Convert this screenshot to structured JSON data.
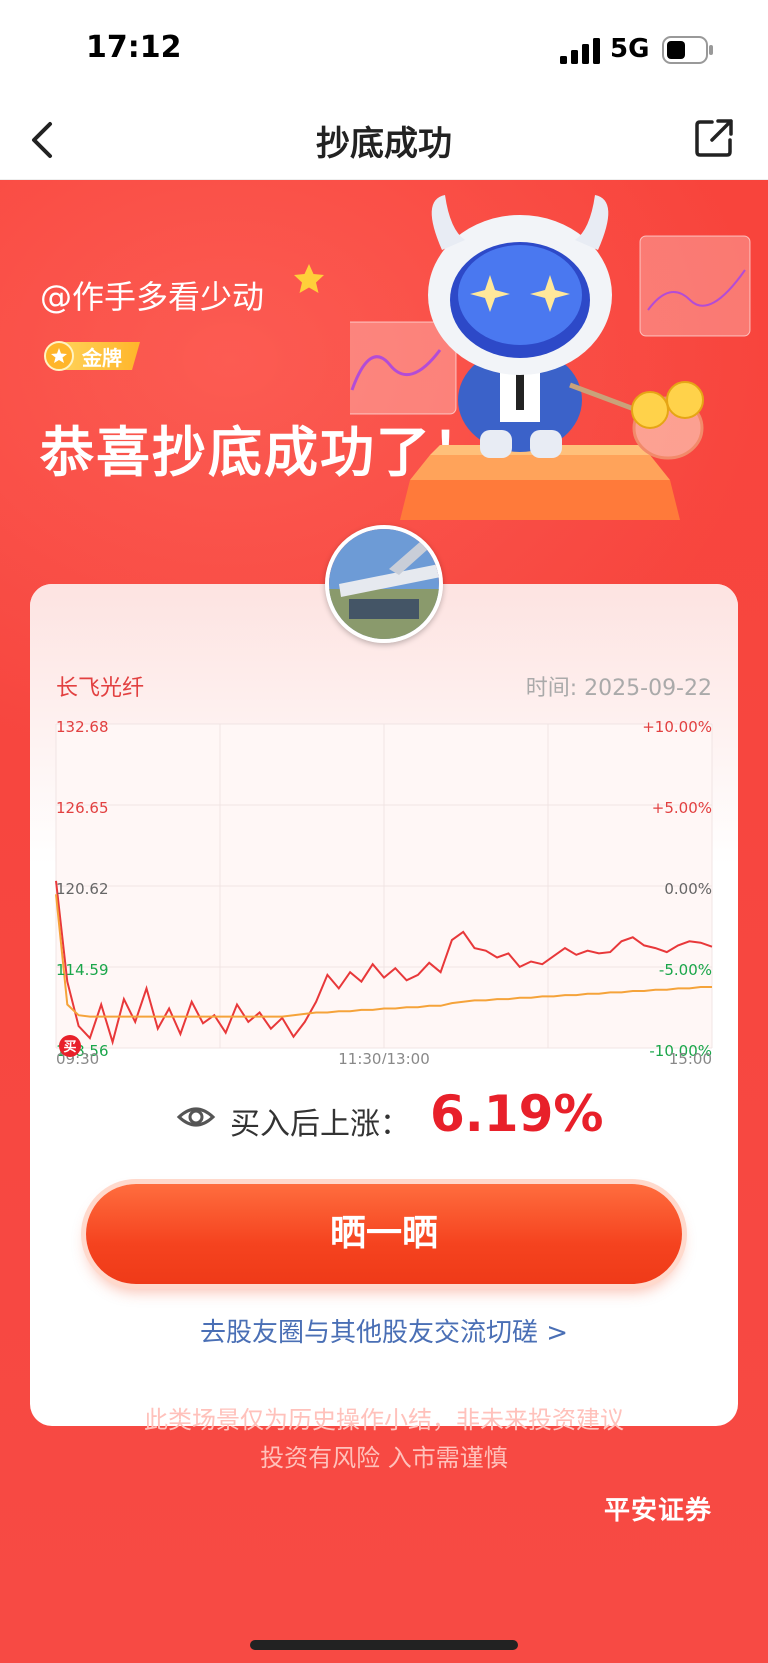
{
  "status": {
    "time": "17:12",
    "network": "5G"
  },
  "nav": {
    "title": "抄底成功"
  },
  "hero": {
    "username": "@作手多看少动",
    "badge_label": "金牌",
    "headline": "恭喜抄底成功了！"
  },
  "card": {
    "stock_name": "长飞光纤",
    "date_text": "时间: 2025-09-22",
    "gain_label": "买入后上涨：",
    "gain_value": "6.19%",
    "share_button": "晒一晒",
    "community_link": "去股友圈与其他股友交流切磋 >"
  },
  "chart_data": {
    "type": "line",
    "price_ticks": [
      "132.68",
      "126.65",
      "120.62",
      "114.59",
      "108.56"
    ],
    "pct_ticks": [
      "+10.00%",
      "+5.00%",
      "0.00%",
      "-5.00%",
      "-10.00%"
    ],
    "x_ticks": [
      "09:30",
      "11:30/13:00",
      "15:00"
    ],
    "ylim": [
      108.56,
      132.68
    ],
    "prev_close": 120.62,
    "buy_marker": {
      "label": "买",
      "time_index": 0,
      "price": 108.56
    },
    "series": [
      {
        "name": "price",
        "color": "#e8383a",
        "values": [
          121.0,
          113.5,
          110.2,
          109.3,
          111.8,
          109.0,
          112.2,
          110.5,
          113.0,
          110.0,
          111.5,
          109.6,
          112.0,
          110.4,
          111.0,
          109.7,
          111.8,
          110.5,
          111.2,
          110.0,
          110.8,
          109.4,
          110.5,
          112.0,
          114.0,
          113.0,
          114.2,
          113.5,
          114.8,
          113.8,
          114.5,
          113.6,
          114.0,
          114.9,
          114.2,
          116.6,
          117.2,
          116.0,
          115.8,
          115.3,
          115.6,
          114.6,
          115.0,
          114.8,
          115.4,
          116.0,
          115.5,
          115.8,
          115.6,
          115.7,
          116.5,
          116.8,
          116.2,
          116.0,
          115.7,
          116.2,
          116.5,
          116.4,
          116.1
        ]
      },
      {
        "name": "average",
        "color": "#f5a33a",
        "values": [
          120.0,
          111.8,
          111.0,
          110.9,
          110.9,
          110.9,
          110.9,
          110.9,
          110.9,
          110.9,
          110.9,
          110.9,
          110.9,
          110.9,
          110.9,
          110.9,
          110.9,
          110.9,
          110.9,
          110.9,
          110.9,
          111.0,
          111.1,
          111.2,
          111.2,
          111.3,
          111.3,
          111.4,
          111.4,
          111.5,
          111.5,
          111.6,
          111.6,
          111.7,
          111.7,
          111.9,
          112.0,
          112.1,
          112.1,
          112.2,
          112.2,
          112.3,
          112.3,
          112.4,
          112.4,
          112.5,
          112.5,
          112.6,
          112.6,
          112.7,
          112.7,
          112.8,
          112.8,
          112.9,
          112.9,
          113.0,
          113.0,
          113.1,
          113.1
        ]
      }
    ],
    "grid": true,
    "colors": {
      "up": "#e24040",
      "down": "#1aa64a",
      "neutral": "#666666"
    }
  },
  "footer": {
    "disclaimer_line1": "此类场景仅为历史操作小结，非未来投资建议",
    "disclaimer_line2": "投资有风险 入市需谨慎",
    "brand": "平安证券"
  }
}
